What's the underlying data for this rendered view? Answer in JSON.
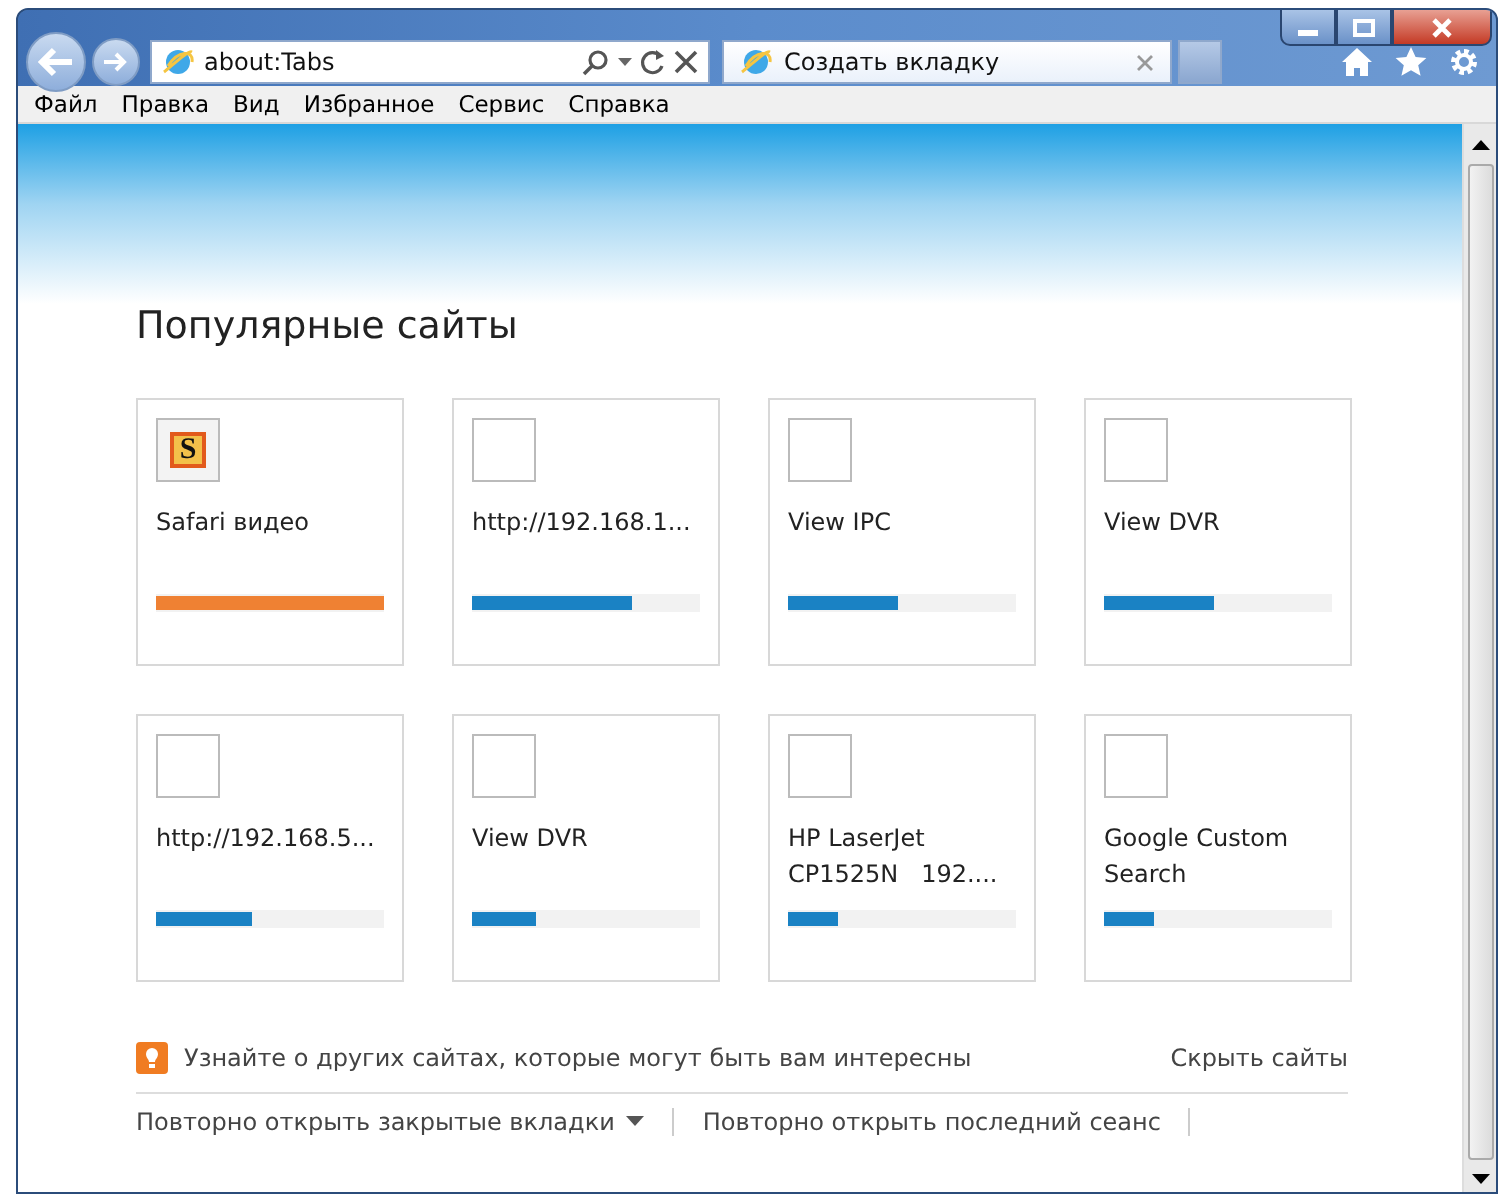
{
  "address_bar": {
    "value": "about:Tabs"
  },
  "tabs": [
    {
      "label": "Создать вкладку",
      "selected": true
    }
  ],
  "menu": [
    "Файл",
    "Правка",
    "Вид",
    "Избранное",
    "Сервис",
    "Справка"
  ],
  "heading": "Популярные сайты",
  "sites": [
    {
      "title": "Safari видео",
      "has_favicon": true,
      "icon_letter": "S",
      "level": 1,
      "color": "#ef8133"
    },
    {
      "title": "http://192.168.1...",
      "has_favicon": false,
      "level": 0.7,
      "color": "#1a82c4"
    },
    {
      "title": "View IPC",
      "has_favicon": false,
      "level": 0.48,
      "color": "#1a82c4"
    },
    {
      "title": "View DVR",
      "has_favicon": false,
      "level": 0.48,
      "color": "#1a82c4"
    },
    {
      "title": "http://192.168.5...",
      "has_favicon": false,
      "level": 0.42,
      "color": "#1a82c4"
    },
    {
      "title": "View DVR",
      "has_favicon": false,
      "level": 0.28,
      "color": "#1a82c4"
    },
    {
      "title": "HP LaserJet CP1525N   192....",
      "has_favicon": false,
      "level": 0.22,
      "color": "#1a82c4"
    },
    {
      "title": "Google Custom Search",
      "has_favicon": false,
      "level": 0.22,
      "color": "#1a82c4"
    }
  ],
  "tip": "Узнайте о других сайтах, которые могут быть вам интересны",
  "hide_link": "Скрыть сайты",
  "footer_links": [
    {
      "label": "Повторно открыть закрытые вкладки",
      "dropdown": true
    },
    {
      "label": "Повторно открыть последний сеанс",
      "dropdown": false
    }
  ]
}
